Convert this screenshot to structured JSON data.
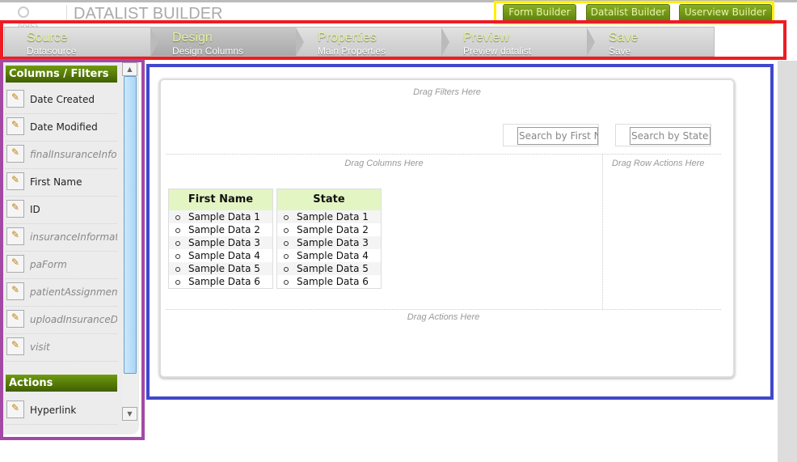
{
  "header": {
    "logo_text": "joget",
    "title": "DATALIST BUILDER"
  },
  "builder_tabs": [
    "Form Builder",
    "Datalist Builder",
    "Userview Builder"
  ],
  "steps": [
    {
      "title": "Source",
      "subtitle": "Datasource"
    },
    {
      "title": "Design",
      "subtitle": "Design Columns",
      "active": true
    },
    {
      "title": "Properties",
      "subtitle": "Main Properties"
    },
    {
      "title": "Preview",
      "subtitle": "Preview datalist"
    },
    {
      "title": "Save",
      "subtitle": "Save"
    }
  ],
  "sidebar": {
    "columns_header": "Columns / Filters",
    "columns": [
      "Date Created",
      "Date Modified",
      "finalInsuranceInfo",
      "First Name",
      "ID",
      "insuranceInformation",
      "paForm",
      "patientAssignment",
      "uploadInsuranceDoc",
      "visit"
    ],
    "actions_header": "Actions",
    "actions": [
      "Hyperlink"
    ]
  },
  "canvas": {
    "filters_hint": "Drag Filters Here",
    "filters": [
      {
        "placeholder": "Search by First Name"
      },
      {
        "placeholder": "Search by State"
      }
    ],
    "columns_hint": "Drag Columns Here",
    "row_actions_hint": "Drag Row Actions Here",
    "actions_hint": "Drag Actions Here",
    "columns": [
      {
        "header": "First Name",
        "rows": [
          "Sample Data 1",
          "Sample Data 2",
          "Sample Data 3",
          "Sample Data 4",
          "Sample Data 5",
          "Sample Data 6"
        ]
      },
      {
        "header": "State",
        "rows": [
          "Sample Data 1",
          "Sample Data 2",
          "Sample Data 3",
          "Sample Data 4",
          "Sample Data 5",
          "Sample Data 6"
        ]
      }
    ]
  }
}
